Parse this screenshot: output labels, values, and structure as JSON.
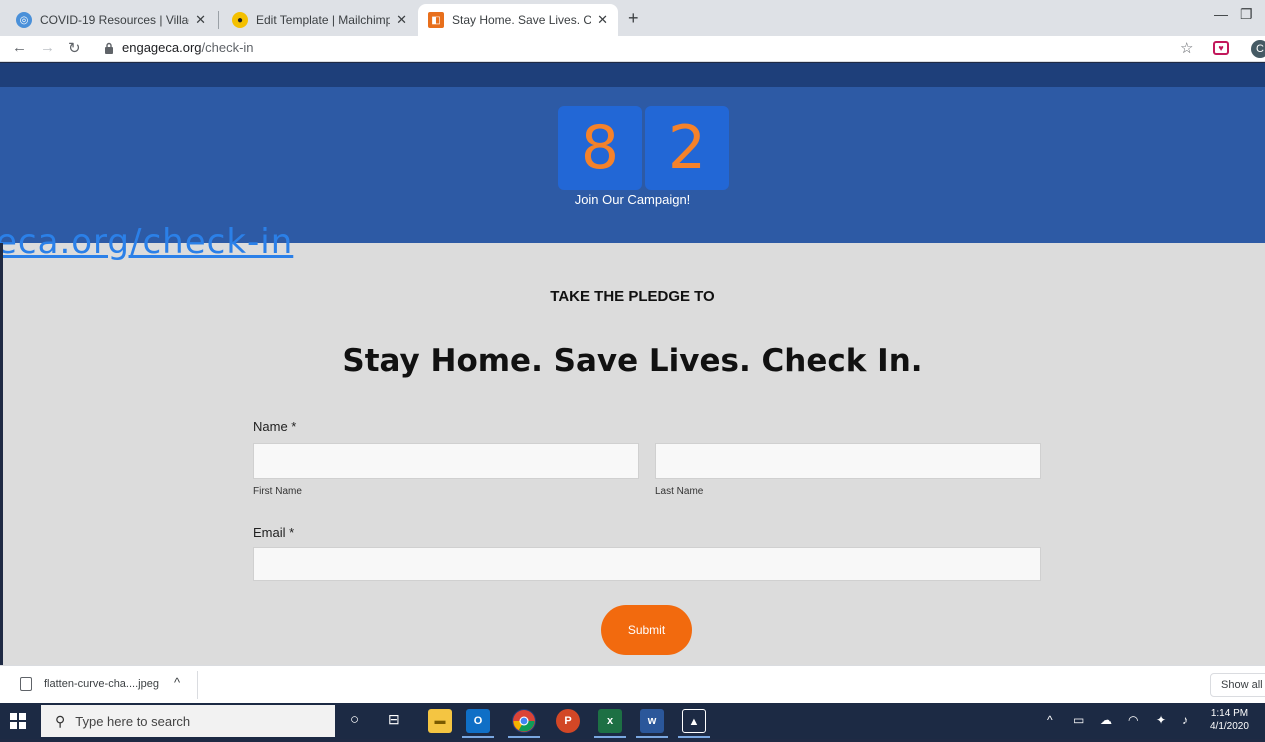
{
  "tabs": [
    {
      "title": "COVID-19 Resources | Village Mc",
      "favicon_color": "#4a90d9"
    },
    {
      "title": "Edit Template | Mailchimp",
      "favicon_color": "#f4c000"
    },
    {
      "title": "Stay Home. Save Lives. Check In.",
      "favicon_color": "#e86f1c"
    }
  ],
  "toolbar": {
    "url_host": "engageca.org",
    "url_path": "/check-in",
    "profile_initial": "C"
  },
  "page": {
    "counter_digits": [
      "8",
      "2"
    ],
    "counter_caption": "Join Our Campaign!",
    "overlay_link": "eca.org/check-in",
    "pledge_kicker": "TAKE THE PLEDGE TO",
    "headline": "Stay Home. Save Lives. Check In.",
    "form": {
      "name_label": "Name *",
      "first_name_sublabel": "First Name",
      "last_name_sublabel": "Last Name",
      "email_label": "Email *",
      "submit_label": "Submit"
    }
  },
  "download_bar": {
    "file_name": "flatten-curve-cha....jpeg",
    "show_all_label": "Show all"
  },
  "taskbar": {
    "search_placeholder": "Type here to search",
    "time": "1:14 PM",
    "date": "4/1/2020"
  },
  "colors": {
    "hero_blue": "#2d5aa5",
    "digit_tile": "#2267d6",
    "digit_orange": "#f5822a",
    "submit_orange": "#f26a0e"
  }
}
